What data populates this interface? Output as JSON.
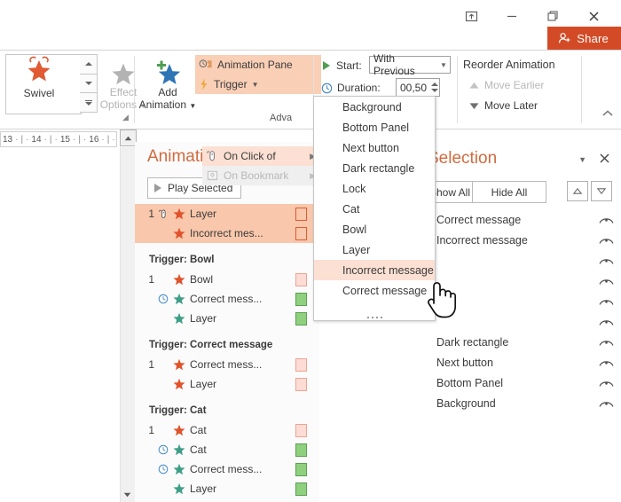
{
  "window": {
    "controls": [
      {
        "name": "ribbon-display-options",
        "glyph": "ribbon"
      },
      {
        "name": "minimize",
        "glyph": "minimize"
      },
      {
        "name": "restore",
        "glyph": "restore"
      },
      {
        "name": "close",
        "glyph": "close"
      }
    ],
    "share_label": "Share",
    "share_color": "#d34b26"
  },
  "ribbon": {
    "gallery": {
      "effect_label": "Swivel",
      "spin_up": "scroll-up",
      "spin_down": "scroll-down",
      "spin_more": "more-effects"
    },
    "effect_options_label": "Effect\nOptions",
    "effect_options_line1": "Effect",
    "effect_options_line2": "Options",
    "add_animation_line1": "Add",
    "add_animation_line2": "Animation",
    "animation_pane_label": "Animation Pane",
    "trigger_label": "Trigger",
    "on_click_of_label": "On Click of",
    "on_bookmark_label": "On Bookmark",
    "advanced_group_label": "Adva",
    "timing": {
      "start_label": "Start:",
      "start_value": "With Previous",
      "duration_label": "Duration:",
      "duration_value": "00,50"
    },
    "reorder": {
      "title": "Reorder Animation",
      "move_earlier": "Move Earlier",
      "move_later": "Move Later"
    }
  },
  "ruler": {
    "ticks": [
      "13",
      "14",
      "15",
      "16"
    ]
  },
  "animation_pane": {
    "title": "Animation Pane",
    "play_label": "Play Selected",
    "groups": [
      {
        "type": "selected",
        "rows": [
          {
            "num": "1",
            "icon": "mouse-click",
            "star": "exit",
            "name": "Layer",
            "bar": "red-outline"
          },
          {
            "num": "",
            "icon": "",
            "star": "exit",
            "name": "Incorrect mes...",
            "bar": "red-outline"
          }
        ]
      },
      {
        "type": "trigger",
        "header": "Trigger: Bowl",
        "rows": [
          {
            "num": "1",
            "icon": "",
            "star": "exit",
            "name": "Bowl",
            "bar": "red-light"
          },
          {
            "num": "",
            "icon": "clock",
            "star": "entrance",
            "name": "Correct mess...",
            "bar": "green"
          },
          {
            "num": "",
            "icon": "",
            "star": "entrance",
            "name": "Layer",
            "bar": "green"
          }
        ]
      },
      {
        "type": "trigger",
        "header": "Trigger: Correct message",
        "rows": [
          {
            "num": "1",
            "icon": "",
            "star": "exit",
            "name": "Correct mess...",
            "bar": "red-light"
          },
          {
            "num": "",
            "icon": "",
            "star": "exit",
            "name": "Layer",
            "bar": "red-light"
          }
        ]
      },
      {
        "type": "trigger",
        "header": "Trigger: Cat",
        "rows": [
          {
            "num": "1",
            "icon": "",
            "star": "exit",
            "name": "Cat",
            "bar": "red-light"
          },
          {
            "num": "",
            "icon": "clock",
            "star": "entrance",
            "name": "Cat",
            "bar": "green"
          },
          {
            "num": "",
            "icon": "clock",
            "star": "entrance",
            "name": "Correct mess...",
            "bar": "green-indent"
          },
          {
            "num": "",
            "icon": "",
            "star": "entrance",
            "name": "Layer",
            "bar": "green-indent"
          }
        ]
      }
    ]
  },
  "selection_pane": {
    "title": "Selection",
    "show_all_label": "Show All",
    "hide_all_label": "Hide All",
    "items": [
      {
        "name": "Correct message",
        "visible": true
      },
      {
        "name": "Incorrect message",
        "visible": true
      },
      {
        "name": "",
        "visible": true
      },
      {
        "name": "",
        "visible": true
      },
      {
        "name": "",
        "visible": true
      },
      {
        "name": "",
        "visible": true
      },
      {
        "name": "Dark rectangle",
        "visible": true
      },
      {
        "name": "Next button",
        "visible": true
      },
      {
        "name": "Bottom Panel",
        "visible": true
      },
      {
        "name": "Background",
        "visible": true
      }
    ]
  },
  "dropdown": {
    "items": [
      {
        "label": "Background",
        "hover": false
      },
      {
        "label": "Bottom Panel",
        "hover": false
      },
      {
        "label": "Next button",
        "hover": false
      },
      {
        "label": "Dark rectangle",
        "hover": false
      },
      {
        "label": "Lock",
        "hover": false
      },
      {
        "label": "Cat",
        "hover": false
      },
      {
        "label": "Bowl",
        "hover": false
      },
      {
        "label": "Layer",
        "hover": false
      },
      {
        "label": "Incorrect message",
        "hover": true
      },
      {
        "label": "Correct message",
        "hover": false
      }
    ],
    "scroll_hint": "more-items"
  },
  "colors": {
    "accent": "#d06b3f",
    "highlight": "#f9c7ab",
    "menu_hover": "#fce0d3",
    "share": "#d34b26",
    "star_exit": "#e0532c",
    "star_entrance": "#3f9e88",
    "green_bar": "#8fd07e"
  }
}
